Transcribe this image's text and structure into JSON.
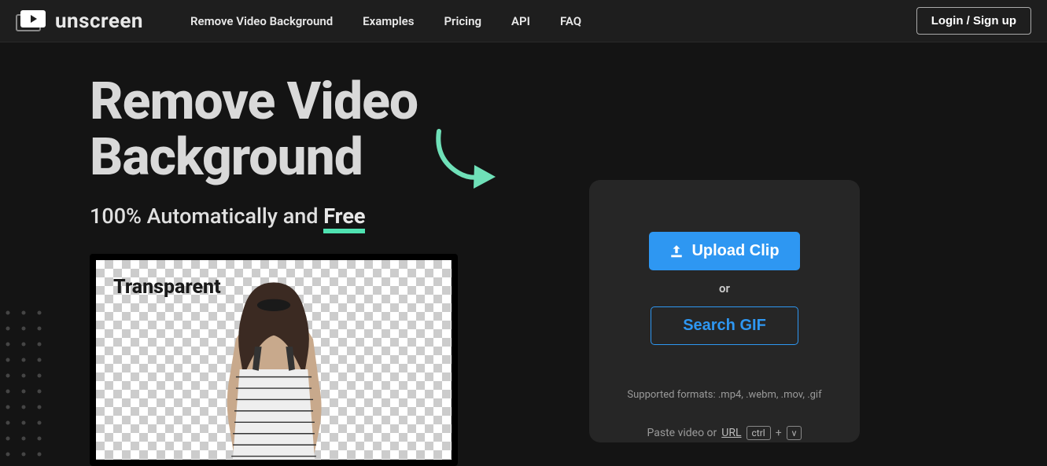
{
  "brand": "unscreen",
  "nav": {
    "items": [
      "Remove Video Background",
      "Examples",
      "Pricing",
      "API",
      "FAQ"
    ],
    "login": "Login / Sign up"
  },
  "hero": {
    "title_line1": "Remove Video",
    "title_line2": "Background",
    "subtitle_prefix": "100% Automatically and ",
    "subtitle_free": "Free",
    "preview_label": "Transparent"
  },
  "upload": {
    "upload_label": "Upload Clip",
    "or": "or",
    "search_gif": "Search GIF",
    "formats": "Supported formats: .mp4, .webm, .mov, .gif",
    "paste_prefix": "Paste video or ",
    "url_text": "URL",
    "kbd1": "ctrl",
    "plus": "+",
    "kbd2": "v"
  }
}
